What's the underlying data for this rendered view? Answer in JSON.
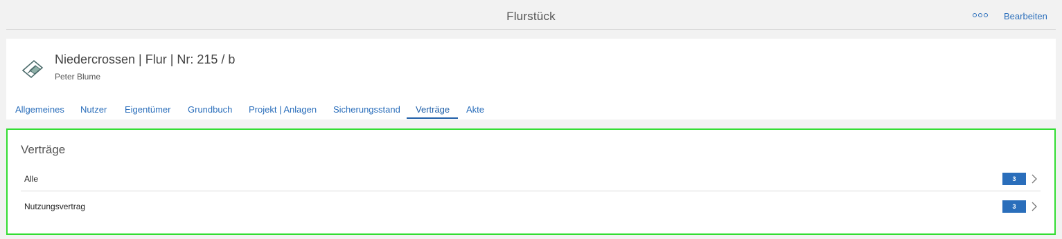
{
  "topbar": {
    "title": "Flurstück",
    "more_icon": "more-horizontal-icon",
    "edit_label": "Bearbeiten"
  },
  "header": {
    "icon": "parcel-icon",
    "title": "Niedercrossen | Flur | Nr: 215 / b",
    "subtitle": "Peter Blume"
  },
  "tabs": [
    {
      "label": "Allgemeines"
    },
    {
      "label": "Nutzer"
    },
    {
      "label": "Eigentümer"
    },
    {
      "label": "Grundbuch"
    },
    {
      "label": "Projekt | Anlagen"
    },
    {
      "label": "Sicherungsstand"
    },
    {
      "label": "Verträge",
      "active": true
    },
    {
      "label": "Akte"
    }
  ],
  "contracts": {
    "title": "Verträge",
    "rows": [
      {
        "label": "Alle",
        "count": "3"
      },
      {
        "label": "Nutzungsvertrag",
        "count": "3"
      }
    ]
  },
  "colors": {
    "accent": "#2a6ebb",
    "highlight_border": "#33dd33",
    "background": "#f2f2f2"
  }
}
